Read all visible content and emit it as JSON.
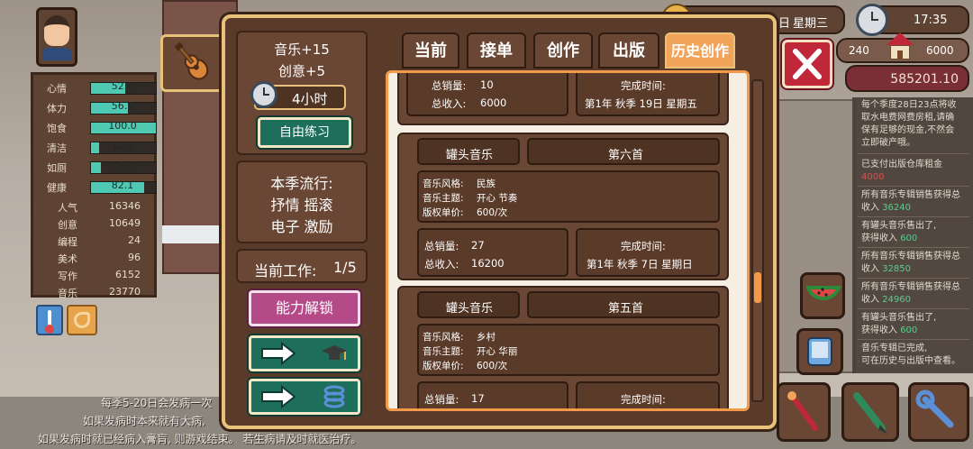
{
  "left_panel": {
    "stats": [
      {
        "label": "心情",
        "value": "52.4",
        "level": 0.524
      },
      {
        "label": "体力",
        "value": "56.8",
        "level": 0.568
      },
      {
        "label": "饱食",
        "value": "100.0",
        "level": 1.0
      },
      {
        "label": "清洁",
        "value": "12.4",
        "level": 0.124
      },
      {
        "label": "如厕",
        "value": "15.4",
        "level": 0.154
      },
      {
        "label": "健康",
        "value": "82.1",
        "level": 0.821
      }
    ],
    "numbers": [
      {
        "label": "人气",
        "value": "16346"
      },
      {
        "label": "创意",
        "value": "10649"
      },
      {
        "label": "编程",
        "value": "24"
      },
      {
        "label": "美术",
        "value": "96"
      },
      {
        "label": "写作",
        "value": "6152"
      },
      {
        "label": "音乐",
        "value": "23770"
      }
    ]
  },
  "top_bar": {
    "day_partial": "日",
    "weekday": "星期三",
    "time": "17:35",
    "stat_a": "240",
    "stat_b": "6000",
    "money": "585201.10"
  },
  "activity": {
    "music_gain": "音乐+15",
    "creativity_gain": "创意+5",
    "duration": "4小时",
    "free_practice": "自由练习"
  },
  "trend": {
    "title": "本季流行:",
    "line1": "抒情 摇滚",
    "line2": "电子 激励"
  },
  "work": {
    "label": "当前工作:",
    "count": "1/5"
  },
  "unlock_button": "能力解锁",
  "tabs": [
    "当前",
    "接单",
    "创作",
    "出版",
    "历史创作"
  ],
  "history": {
    "first_card": {
      "sales_label": "总销量:",
      "sales": "10",
      "income_label": "总收入:",
      "income": "6000",
      "done_label": "完成时间:",
      "done": "第1年 秋季 19日  星期五"
    },
    "cards": [
      {
        "type": "罐头音乐",
        "title": "第六首",
        "style_label": "音乐风格:",
        "style": "民族",
        "theme_label": "音乐主题:",
        "theme": "开心 节奏",
        "price_label": "版权单价:",
        "price": "600/次",
        "sales_label": "总销量:",
        "sales": "27",
        "income_label": "总收入:",
        "income": "16200",
        "done_label": "完成时间:",
        "done": "第1年 秋季 7日  星期日"
      },
      {
        "type": "罐头音乐",
        "title": "第五首",
        "style_label": "音乐风格:",
        "style": "乡村",
        "theme_label": "音乐主题:",
        "theme": "开心 华丽",
        "price_label": "版权单价:",
        "price": "600/次",
        "sales_label": "总销量:",
        "sales": "17",
        "done_label": "完成时间:"
      }
    ]
  },
  "notices": {
    "n1a": "每个季度28日23点将收",
    "n1b": "取水电费网费房租,请确",
    "n1c": "保有足够的现金,不然会",
    "n1d": "立即破产哦。",
    "n2a": "已支付出版仓库租金",
    "n2b": "4000",
    "n3a": "所有音乐专辑销售获得总",
    "n3b": "收入",
    "n3c": "36240",
    "n4a": "有罐头音乐售出了,",
    "n4b": "获得收入",
    "n4c": "600",
    "n5a": "所有音乐专辑销售获得总",
    "n5b": "收入",
    "n5c": "32850",
    "n6a": "所有音乐专辑销售获得总",
    "n6b": "收入",
    "n6c": "24960",
    "n7a": "有罐头音乐售出了,",
    "n7b": "获得收入",
    "n7c": "600",
    "n8a": "音乐专辑已完成,",
    "n8b": "可在历史与出版中查看。"
  },
  "bottom_tips": {
    "line1": "每季5-20日会发病一次",
    "line2": "如果发病时本来就有大病,",
    "line3": "如果发病时就已经病入膏肓, 则游戏结束。 若生病请及时就医治疗。"
  },
  "colors": {
    "accent": "#f29a4a",
    "panel": "#5a3a28",
    "green": "#1d6e5a",
    "pink": "#b44a88",
    "close": "#c0283a",
    "money": "#7a2e36"
  }
}
